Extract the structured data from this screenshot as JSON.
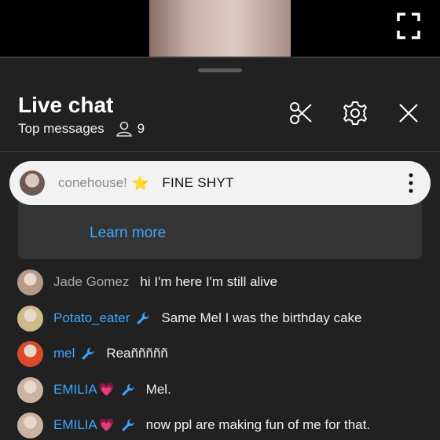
{
  "header": {
    "title": "Live chat",
    "mode": "Top messages",
    "viewer_count": "9"
  },
  "pinned": {
    "author": "conehouse!",
    "badge": "⭐",
    "message": "FINE SHYT",
    "learn_more": "Learn more"
  },
  "messages": [
    {
      "author": "Jade Gomez",
      "author_style": "grey",
      "emoji": "",
      "moderator": false,
      "text": "hi I'm here I'm still alive",
      "avatar_color": "#b59a88"
    },
    {
      "author": "Potato_eater",
      "author_style": "blue",
      "emoji": "",
      "moderator": true,
      "text": "Same Mel I was the birthday cake",
      "avatar_color": "#cdbb8a"
    },
    {
      "author": "mel",
      "author_style": "blue",
      "emoji": "",
      "moderator": true,
      "text": "Reañññññ",
      "avatar_color": "#d84a2a"
    },
    {
      "author": "EMILIA",
      "author_style": "blue",
      "emoji": "💗",
      "moderator": true,
      "text": "Mel.",
      "avatar_color": "#c9b3a4"
    },
    {
      "author": "EMILIA",
      "author_style": "blue",
      "emoji": "💗",
      "moderator": true,
      "text": "now ppl are making fun of me for that.",
      "avatar_color": "#c9b3a4"
    }
  ],
  "colors": {
    "accent_blue": "#3ea6ff",
    "sheet_bg": "#212121",
    "pill_bg": "#f2f2f2"
  }
}
